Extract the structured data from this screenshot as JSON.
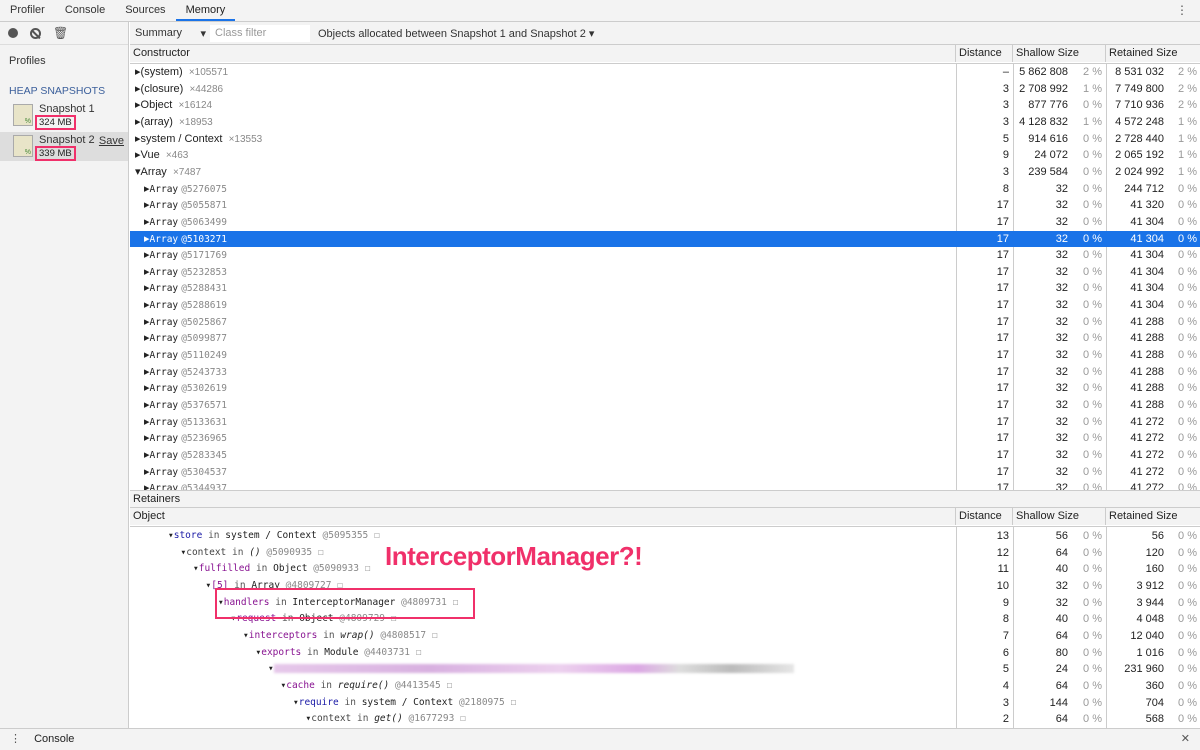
{
  "tabs": [
    "Profiler",
    "Console",
    "Sources",
    "Memory"
  ],
  "active_tab": "Memory",
  "sidebar": {
    "profiles_label": "Profiles",
    "section": "HEAP SNAPSHOTS",
    "snapshots": [
      {
        "name": "Snapshot 1",
        "size": "324 MB"
      },
      {
        "name": "Snapshot 2",
        "size": "339 MB",
        "save": "Save"
      }
    ]
  },
  "toolbar": {
    "view": "Summary",
    "filter_placeholder": "Class filter",
    "range": "Objects allocated between Snapshot 1 and Snapshot 2"
  },
  "columns": {
    "constructor": "Constructor",
    "object": "Object",
    "distance": "Distance",
    "shallow": "Shallow Size",
    "retained": "Retained Size"
  },
  "rows": [
    {
      "name": "(system)",
      "count": "×105571",
      "dist": "–",
      "sh": "5 862 808",
      "shp": "2 %",
      "rt": "8 531 032",
      "rtp": "2 %"
    },
    {
      "name": "(closure)",
      "count": "×44286",
      "dist": "3",
      "sh": "2 708 992",
      "shp": "1 %",
      "rt": "7 749 800",
      "rtp": "2 %"
    },
    {
      "name": "Object",
      "count": "×16124",
      "dist": "3",
      "sh": "877 776",
      "shp": "0 %",
      "rt": "7 710 936",
      "rtp": "2 %"
    },
    {
      "name": "(array)",
      "count": "×18953",
      "dist": "3",
      "sh": "4 128 832",
      "shp": "1 %",
      "rt": "4 572 248",
      "rtp": "1 %"
    },
    {
      "name": "system / Context",
      "count": "×13553",
      "dist": "5",
      "sh": "914 616",
      "shp": "0 %",
      "rt": "2 728 440",
      "rtp": "1 %"
    },
    {
      "name": "Vue",
      "count": "×463",
      "dist": "9",
      "sh": "24 072",
      "shp": "0 %",
      "rt": "2 065 192",
      "rtp": "1 %"
    },
    {
      "name": "Array",
      "count": "×7487",
      "dist": "3",
      "sh": "239 584",
      "shp": "0 %",
      "rt": "2 024 992",
      "rtp": "1 %",
      "open": true
    },
    {
      "name": "Array",
      "id": "@5276075",
      "dist": "8",
      "sh": "32",
      "shp": "0 %",
      "rt": "244 712",
      "rtp": "0 %"
    },
    {
      "name": "Array",
      "id": "@5055871",
      "dist": "17",
      "sh": "32",
      "shp": "0 %",
      "rt": "41 320",
      "rtp": "0 %"
    },
    {
      "name": "Array",
      "id": "@5063499",
      "dist": "17",
      "sh": "32",
      "shp": "0 %",
      "rt": "41 304",
      "rtp": "0 %"
    },
    {
      "name": "Array",
      "id": "@5103271",
      "dist": "17",
      "sh": "32",
      "shp": "0 %",
      "rt": "41 304",
      "rtp": "0 %",
      "selected": true
    },
    {
      "name": "Array",
      "id": "@5171769",
      "dist": "17",
      "sh": "32",
      "shp": "0 %",
      "rt": "41 304",
      "rtp": "0 %"
    },
    {
      "name": "Array",
      "id": "@5232853",
      "dist": "17",
      "sh": "32",
      "shp": "0 %",
      "rt": "41 304",
      "rtp": "0 %"
    },
    {
      "name": "Array",
      "id": "@5288431",
      "dist": "17",
      "sh": "32",
      "shp": "0 %",
      "rt": "41 304",
      "rtp": "0 %"
    },
    {
      "name": "Array",
      "id": "@5288619",
      "dist": "17",
      "sh": "32",
      "shp": "0 %",
      "rt": "41 304",
      "rtp": "0 %"
    },
    {
      "name": "Array",
      "id": "@5025867",
      "dist": "17",
      "sh": "32",
      "shp": "0 %",
      "rt": "41 288",
      "rtp": "0 %"
    },
    {
      "name": "Array",
      "id": "@5099877",
      "dist": "17",
      "sh": "32",
      "shp": "0 %",
      "rt": "41 288",
      "rtp": "0 %"
    },
    {
      "name": "Array",
      "id": "@5110249",
      "dist": "17",
      "sh": "32",
      "shp": "0 %",
      "rt": "41 288",
      "rtp": "0 %"
    },
    {
      "name": "Array",
      "id": "@5243733",
      "dist": "17",
      "sh": "32",
      "shp": "0 %",
      "rt": "41 288",
      "rtp": "0 %"
    },
    {
      "name": "Array",
      "id": "@5302619",
      "dist": "17",
      "sh": "32",
      "shp": "0 %",
      "rt": "41 288",
      "rtp": "0 %"
    },
    {
      "name": "Array",
      "id": "@5376571",
      "dist": "17",
      "sh": "32",
      "shp": "0 %",
      "rt": "41 288",
      "rtp": "0 %"
    },
    {
      "name": "Array",
      "id": "@5133631",
      "dist": "17",
      "sh": "32",
      "shp": "0 %",
      "rt": "41 272",
      "rtp": "0 %"
    },
    {
      "name": "Array",
      "id": "@5236965",
      "dist": "17",
      "sh": "32",
      "shp": "0 %",
      "rt": "41 272",
      "rtp": "0 %"
    },
    {
      "name": "Array",
      "id": "@5283345",
      "dist": "17",
      "sh": "32",
      "shp": "0 %",
      "rt": "41 272",
      "rtp": "0 %"
    },
    {
      "name": "Array",
      "id": "@5304537",
      "dist": "17",
      "sh": "32",
      "shp": "0 %",
      "rt": "41 272",
      "rtp": "0 %"
    },
    {
      "name": "Array",
      "id": "@5344937",
      "dist": "17",
      "sh": "32",
      "shp": "0 %",
      "rt": "41 272",
      "rtp": "0 %"
    }
  ],
  "retainers_title": "Retainers",
  "retainers": [
    {
      "prop": "store",
      "kind": "b",
      "in": "in",
      "obj": "system / Context",
      "id": "@5095355",
      "level": 0,
      "dist": "13",
      "sh": "56",
      "shp": "0 %",
      "rt": "56",
      "rtp": "0 %"
    },
    {
      "prop": "context",
      "kind": "g",
      "in": "in",
      "obj": "()",
      "italic": true,
      "id": "@5090935",
      "level": 1,
      "dist": "12",
      "sh": "64",
      "shp": "0 %",
      "rt": "120",
      "rtp": "0 %"
    },
    {
      "prop": "fulfilled",
      "kind": "p",
      "in": "in",
      "obj": "Object",
      "id": "@5090933",
      "level": 2,
      "dist": "11",
      "sh": "40",
      "shp": "0 %",
      "rt": "160",
      "rtp": "0 %"
    },
    {
      "prop": "[5]",
      "kind": "p",
      "in": "in",
      "obj": "Array",
      "id": "@4809727",
      "level": 3,
      "dist": "10",
      "sh": "32",
      "shp": "0 %",
      "rt": "3 912",
      "rtp": "0 %"
    },
    {
      "prop": "handlers",
      "kind": "p",
      "in": "in",
      "obj": "InterceptorManager",
      "id": "@4809731",
      "level": 4,
      "dist": "9",
      "sh": "32",
      "shp": "0 %",
      "rt": "3 944",
      "rtp": "0 %"
    },
    {
      "prop": "request",
      "kind": "p",
      "in": "in",
      "obj": "Object",
      "id": "@4809729",
      "level": 5,
      "dist": "8",
      "sh": "40",
      "shp": "0 %",
      "rt": "4 048",
      "rtp": "0 %"
    },
    {
      "prop": "interceptors",
      "kind": "p",
      "in": "in",
      "obj": "wrap()",
      "italic": true,
      "id": "@4808517",
      "level": 6,
      "dist": "7",
      "sh": "64",
      "shp": "0 %",
      "rt": "12 040",
      "rtp": "0 %"
    },
    {
      "prop": "exports",
      "kind": "p",
      "in": "in",
      "obj": "Module",
      "id": "@4403731",
      "level": 7,
      "dist": "6",
      "sh": "80",
      "shp": "0 %",
      "rt": "1 016",
      "rtp": "0 %"
    },
    {
      "blurred": true,
      "level": 8,
      "dist": "5",
      "sh": "24",
      "shp": "0 %",
      "rt": "231 960",
      "rtp": "0 %"
    },
    {
      "prop": "cache",
      "kind": "p",
      "in": "in",
      "obj": "require()",
      "italic": true,
      "id": "@4413545",
      "level": 9,
      "dist": "4",
      "sh": "64",
      "shp": "0 %",
      "rt": "360",
      "rtp": "0 %"
    },
    {
      "prop": "require",
      "kind": "b",
      "in": "in",
      "obj": "system / Context",
      "id": "@2180975",
      "level": 10,
      "dist": "3",
      "sh": "144",
      "shp": "0 %",
      "rt": "704",
      "rtp": "0 %"
    },
    {
      "prop": "context",
      "kind": "g",
      "in": "in",
      "obj": "get()",
      "italic": true,
      "id": "@1677293",
      "level": 11,
      "dist": "2",
      "sh": "64",
      "shp": "0 %",
      "rt": "568",
      "rtp": "0 %"
    }
  ],
  "annotation": "InterceptorManager?!",
  "drawer": {
    "label": "Console"
  },
  "colors": {
    "selection": "#1a73e8",
    "annotation": "#f0306a",
    "property": "#881391"
  }
}
